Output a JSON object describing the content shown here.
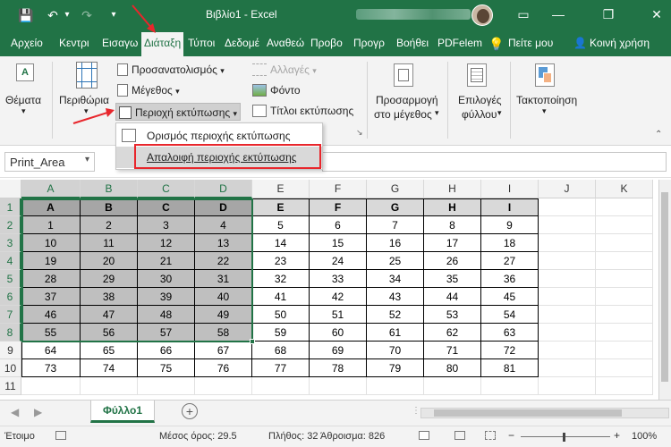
{
  "window": {
    "title": "Βιβλίο1  -  Excel",
    "minimize": "—",
    "restore": "❐",
    "close": "✕",
    "ribbon_display": "▭"
  },
  "quick_access": {
    "save": "💾",
    "undo": "↶",
    "undo_dd": "▾",
    "redo": "↷",
    "customize": "▾"
  },
  "tabs": [
    "Αρχείο",
    "Κεντρι",
    "Εισαγω",
    "Διάταξη",
    "Τύποι",
    "Δεδομέ",
    "Αναθεώ",
    "Προβο",
    "Προγρ",
    "Βοήθει",
    "PDFelem",
    "Πείτε μου",
    "Κοινή χρήση"
  ],
  "active_tab_index": 3,
  "ribbon": {
    "themes": "Θέματα",
    "margins": "Περιθώρια",
    "orientation": "Προσανατολισμός",
    "size": "Μέγεθος",
    "print_area": "Περιοχή εκτύπωσης",
    "breaks": "Αλλαγές",
    "background": "Φόντο",
    "print_titles": "Τίτλοι εκτύπωσης",
    "scale_to_fit_1": "Προσαρμογή",
    "scale_to_fit_2": "στο μέγεθος",
    "sheet_options_1": "Επιλογές",
    "sheet_options_2": "φύλλου",
    "arrange": "Τακτοποίηση"
  },
  "dropdown": {
    "set_print_area": "Ορισμός περιοχής εκτύπωσης",
    "clear_print_area": "Απαλοιφή περιοχής εκτύπωσης"
  },
  "name_box": "Print_Area",
  "columns": [
    "A",
    "B",
    "C",
    "D",
    "E",
    "F",
    "G",
    "H",
    "I",
    "J",
    "K"
  ],
  "rows": [
    [
      "A",
      "B",
      "C",
      "D",
      "E",
      "F",
      "G",
      "H",
      "I"
    ],
    [
      "1",
      "2",
      "3",
      "4",
      "5",
      "6",
      "7",
      "8",
      "9"
    ],
    [
      "10",
      "11",
      "12",
      "13",
      "14",
      "15",
      "16",
      "17",
      "18"
    ],
    [
      "19",
      "20",
      "21",
      "22",
      "23",
      "24",
      "25",
      "26",
      "27"
    ],
    [
      "28",
      "29",
      "30",
      "31",
      "32",
      "33",
      "34",
      "35",
      "36"
    ],
    [
      "37",
      "38",
      "39",
      "40",
      "41",
      "42",
      "43",
      "44",
      "45"
    ],
    [
      "46",
      "47",
      "48",
      "49",
      "50",
      "51",
      "52",
      "53",
      "54"
    ],
    [
      "55",
      "56",
      "57",
      "58",
      "59",
      "60",
      "61",
      "62",
      "63"
    ],
    [
      "64",
      "65",
      "66",
      "67",
      "68",
      "69",
      "70",
      "71",
      "72"
    ],
    [
      "73",
      "74",
      "75",
      "76",
      "77",
      "78",
      "79",
      "80",
      "81"
    ],
    [
      "",
      "",
      "",
      "",
      "",
      "",
      "",
      "",
      ""
    ]
  ],
  "sheet_tab": "Φύλλο1",
  "status": {
    "ready": "Έτοιμο",
    "average": "Μέσος όρος: 29.5",
    "count": "Πλήθος: 32",
    "sum": "Άθροισμα: 826",
    "zoom": "100%"
  },
  "colors": {
    "excel_green": "#217346",
    "selection_gray": "#bfbfbf",
    "header_gray": "#a6a6a6",
    "highlight_red": "#e8262c"
  }
}
